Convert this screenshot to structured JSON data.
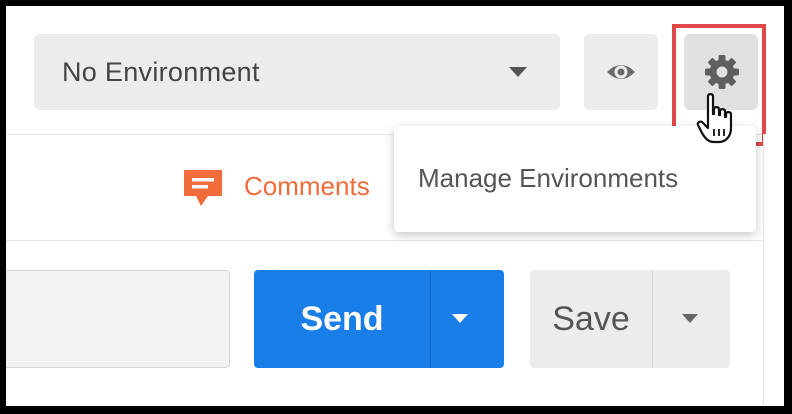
{
  "environment": {
    "selected": "No Environment",
    "caret_icon": "chevron-down-icon"
  },
  "toolbar": {
    "eye_icon": "eye-icon",
    "gear_icon": "gear-icon"
  },
  "manage_menu": {
    "items": [
      {
        "label": "Manage Environments"
      }
    ]
  },
  "comments": {
    "label": "Comments",
    "icon": "comment-icon",
    "color": "#f26b3a"
  },
  "request": {
    "send_label": "Send",
    "save_label": "Save",
    "send_color": "#1a7ee8"
  },
  "highlight_color": "#e04848"
}
